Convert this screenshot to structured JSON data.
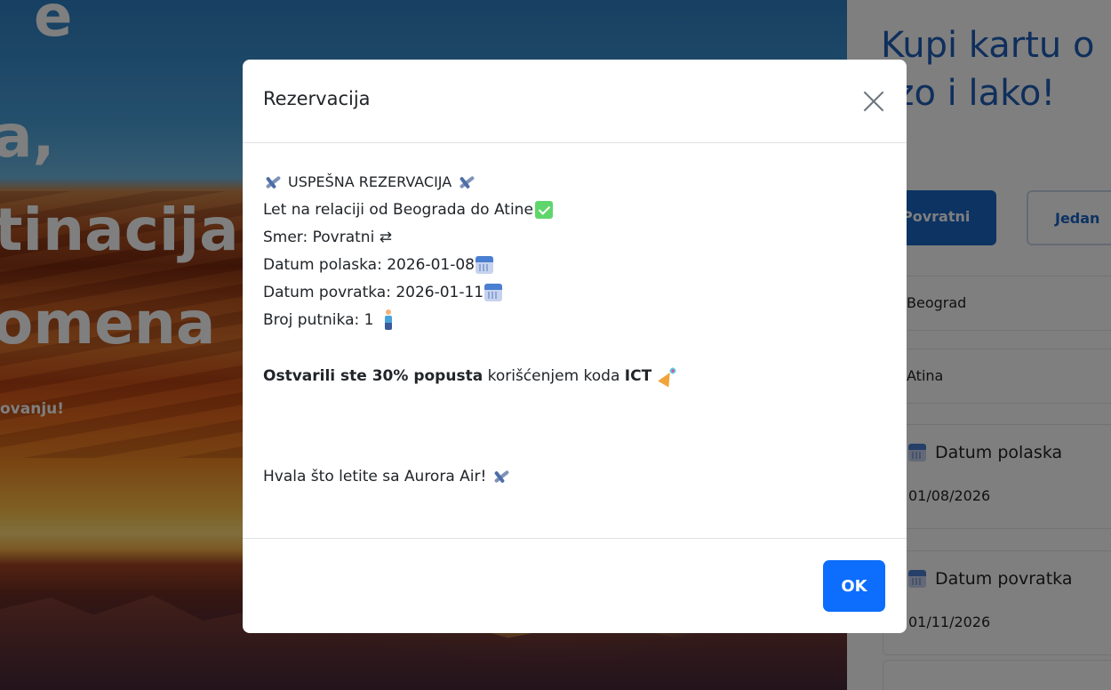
{
  "hero": {
    "line1": "e",
    "line2": "a,",
    "line3": "tinacija",
    "line4": "omena",
    "subtitle": "ovanju!"
  },
  "sidebar": {
    "title_line1": "Kupi kartu o",
    "title_line2": "rzo i lako!",
    "trip_round": "Povratni",
    "trip_oneway": "Jedan",
    "from_value": "Beograd",
    "to_value": "Atina",
    "departure_label": "Datum polaska",
    "departure_value": "01/08/2026",
    "return_label": "Datum povratka",
    "return_value": "01/11/2026"
  },
  "modal": {
    "title": "Rezervacija",
    "heading": "USPEŠNA REZERVACIJA",
    "route": "Let na relaciji od Beograda do Atine",
    "direction": "Smer: Povratni ⇄",
    "departure": "Datum polaska: 2026-01-08",
    "return": "Datum povratka: 2026-01-11",
    "passengers": "Broj putnika: 1",
    "discount_bold": "Ostvarili ste 30% popusta",
    "discount_text": " korišćenjem koda ",
    "discount_code": "ICT",
    "thanks": "Hvala što letite sa Aurora Air!",
    "ok_label": "OK"
  },
  "icons": {
    "plane": "airplane-icon",
    "check": "check-icon",
    "calendar": "calendar-icon",
    "person": "person-icon",
    "party": "party-popper-icon",
    "close": "close-icon"
  },
  "colors": {
    "primary": "#0d6efd",
    "brand": "#1e5eb8",
    "check": "#5fd66b"
  }
}
